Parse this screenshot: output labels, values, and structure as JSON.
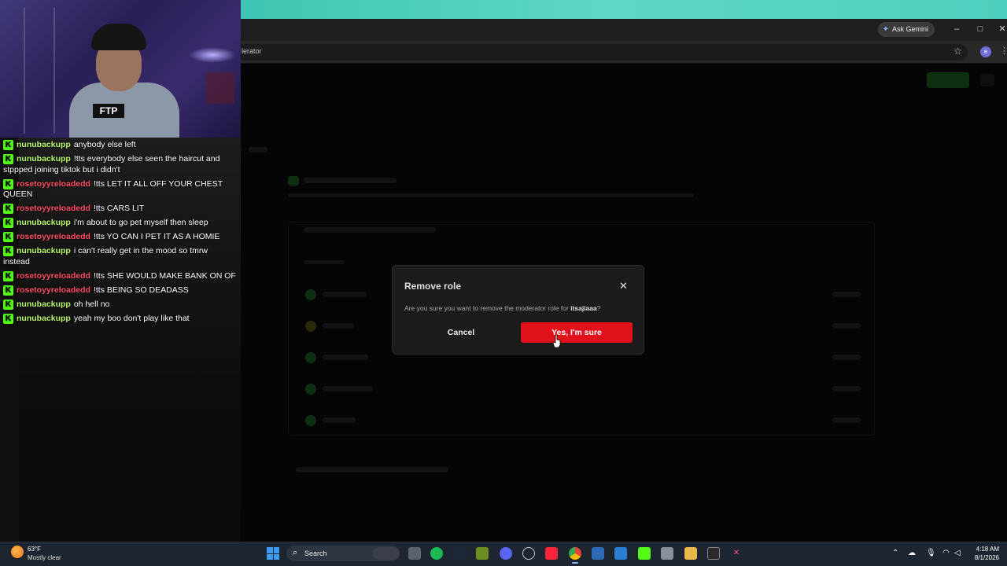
{
  "browser": {
    "gemini_label": "Ask Gemini",
    "url_fragment": "lerator",
    "profile_initial": "e",
    "minimize_glyph": "–",
    "maximize_glyph": "□",
    "close_glyph": "✕"
  },
  "webcam": {
    "shirt_text": "FTP"
  },
  "chat": {
    "badge": "K",
    "messages": [
      {
        "user": "nunubackupp",
        "color": "green",
        "text": "anybody else left"
      },
      {
        "user": "nunubackupp",
        "color": "green",
        "text": "!tts everybody else seen the haircut and stppped joining tiktok but i didn't"
      },
      {
        "user": "rosetoyyreloadedd",
        "color": "red",
        "text": "!tts LET IT ALL OFF YOUR CHEST QUEEN"
      },
      {
        "user": "rosetoyyreloadedd",
        "color": "red",
        "text": "!tts CARS LIT"
      },
      {
        "user": "nunubackupp",
        "color": "green",
        "text": "i'm about to go pet myself then sleep"
      },
      {
        "user": "rosetoyyreloadedd",
        "color": "red",
        "text": "!tts YO CAN I PET IT AS A HOMIE"
      },
      {
        "user": "nunubackupp",
        "color": "green",
        "text": "i can't really get in the mood so tmrw instead"
      },
      {
        "user": "rosetoyyreloadedd",
        "color": "red",
        "text": "!tts SHE WOULD MAKE BANK ON OF"
      },
      {
        "user": "rosetoyyreloadedd",
        "color": "red",
        "text": "!tts BEING SO DEADASS"
      },
      {
        "user": "nunubackupp",
        "color": "green",
        "text": "oh hell no"
      },
      {
        "user": "nunubackupp",
        "color": "green",
        "text": "yeah my boo don't play like that"
      }
    ]
  },
  "modal": {
    "title": "Remove role",
    "close_glyph": "✕",
    "body_prefix": "Are you sure you want to remove the moderator role for ",
    "body_user": "itsajiaaa",
    "body_suffix": "?",
    "cancel_label": "Cancel",
    "confirm_label": "Yes, I'm sure"
  },
  "taskbar": {
    "weather_temp": "63°F",
    "weather_condition": "Mostly clear",
    "search_label": "Search",
    "clock_time": "4:18 AM",
    "clock_date": "8/1/2026"
  },
  "colors": {
    "kick_green": "#53fc18",
    "danger_red": "#e0111a",
    "username_green": "#b9f76a",
    "username_red": "#ff4d63"
  }
}
